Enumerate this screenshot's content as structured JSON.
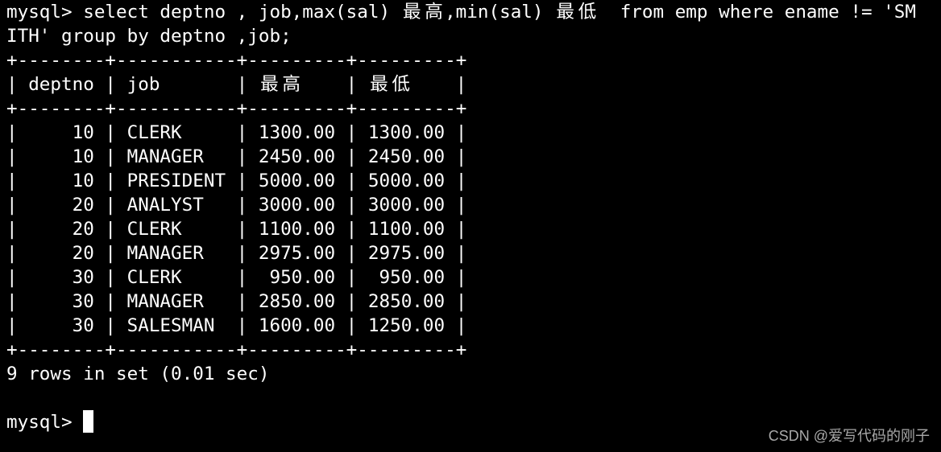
{
  "terminal": {
    "prompt": "mysql> ",
    "command_lines": [
      "select deptno , job,max(sal) 最高,min(sal) 最低  from emp where ename != 'SM",
      "ITH' group by deptno ,job;"
    ],
    "table": {
      "border": "+--------+-----------+---------+---------+",
      "columns": [
        "deptno",
        "job",
        "最高",
        "最低"
      ],
      "rows": [
        {
          "deptno": "10",
          "job": "CLERK",
          "max": "1300.00",
          "min": "1300.00"
        },
        {
          "deptno": "10",
          "job": "MANAGER",
          "max": "2450.00",
          "min": "2450.00"
        },
        {
          "deptno": "10",
          "job": "PRESIDENT",
          "max": "5000.00",
          "min": "5000.00"
        },
        {
          "deptno": "20",
          "job": "ANALYST",
          "max": "3000.00",
          "min": "3000.00"
        },
        {
          "deptno": "20",
          "job": "CLERK",
          "max": "1100.00",
          "min": "1100.00"
        },
        {
          "deptno": "20",
          "job": "MANAGER",
          "max": "2975.00",
          "min": "2975.00"
        },
        {
          "deptno": "30",
          "job": "CLERK",
          "max": "950.00",
          "min": "950.00"
        },
        {
          "deptno": "30",
          "job": "MANAGER",
          "max": "2850.00",
          "min": "2850.00"
        },
        {
          "deptno": "30",
          "job": "SALESMAN",
          "max": "1600.00",
          "min": "1250.00"
        }
      ]
    },
    "result_summary": "9 rows in set (0.01 sec)",
    "final_prompt": "mysql> "
  },
  "watermark": "CSDN @爱写代码的刚子",
  "colors": {
    "background": "#000000",
    "text": "#ffffff",
    "watermark": "#a8a8a8"
  }
}
